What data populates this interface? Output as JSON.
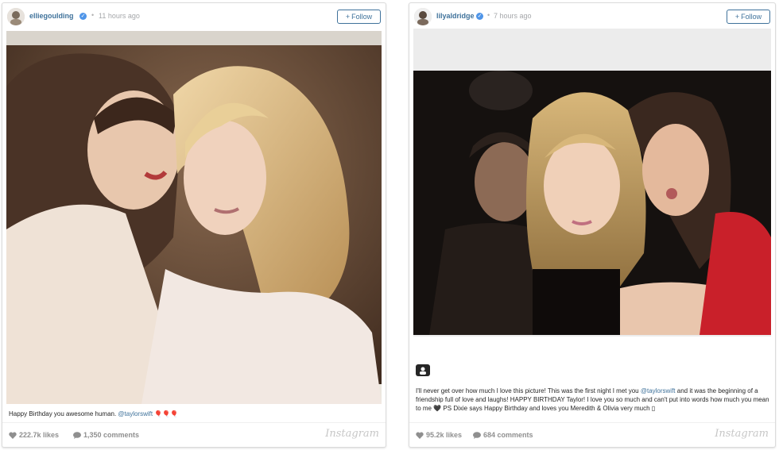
{
  "posts": [
    {
      "username": "elliegoulding",
      "time": "11 hours ago",
      "follow_label": "Follow",
      "caption_text": "Happy Birthday you awesome human. ",
      "caption_mention": "@taylorswift",
      "caption_emoji": "🎈🎈🎈",
      "likes": "222.7k likes",
      "comments": "1,350 comments",
      "logo": "Instagram"
    },
    {
      "username": "lilyaldridge",
      "time": "7 hours ago",
      "follow_label": "Follow",
      "caption_text_1": "I'll never get over how much I love this picture! This was the first night I met you ",
      "caption_mention": "@taylorswift",
      "caption_text_2": " and it was the beginning of a friendship full of love and laughs! HAPPY BIRTHDAY Taylor! I love you so much and can't put into words how much you mean to me ",
      "caption_heart": "🖤",
      "caption_text_3": " PS Dixie says Happy Birthday and loves you Meredith & Olivia very much ",
      "caption_end": "▯",
      "likes": "95.2k likes",
      "comments": "684 comments",
      "logo": "Instagram"
    }
  ],
  "colors": {
    "link_blue": "#3f729b",
    "verified_blue": "#4f95e8",
    "muted_gray": "#8f8f8f"
  },
  "icons": [
    "verified-badge-icon",
    "plus-icon",
    "heart-icon",
    "comment-icon",
    "user-tag-icon"
  ]
}
